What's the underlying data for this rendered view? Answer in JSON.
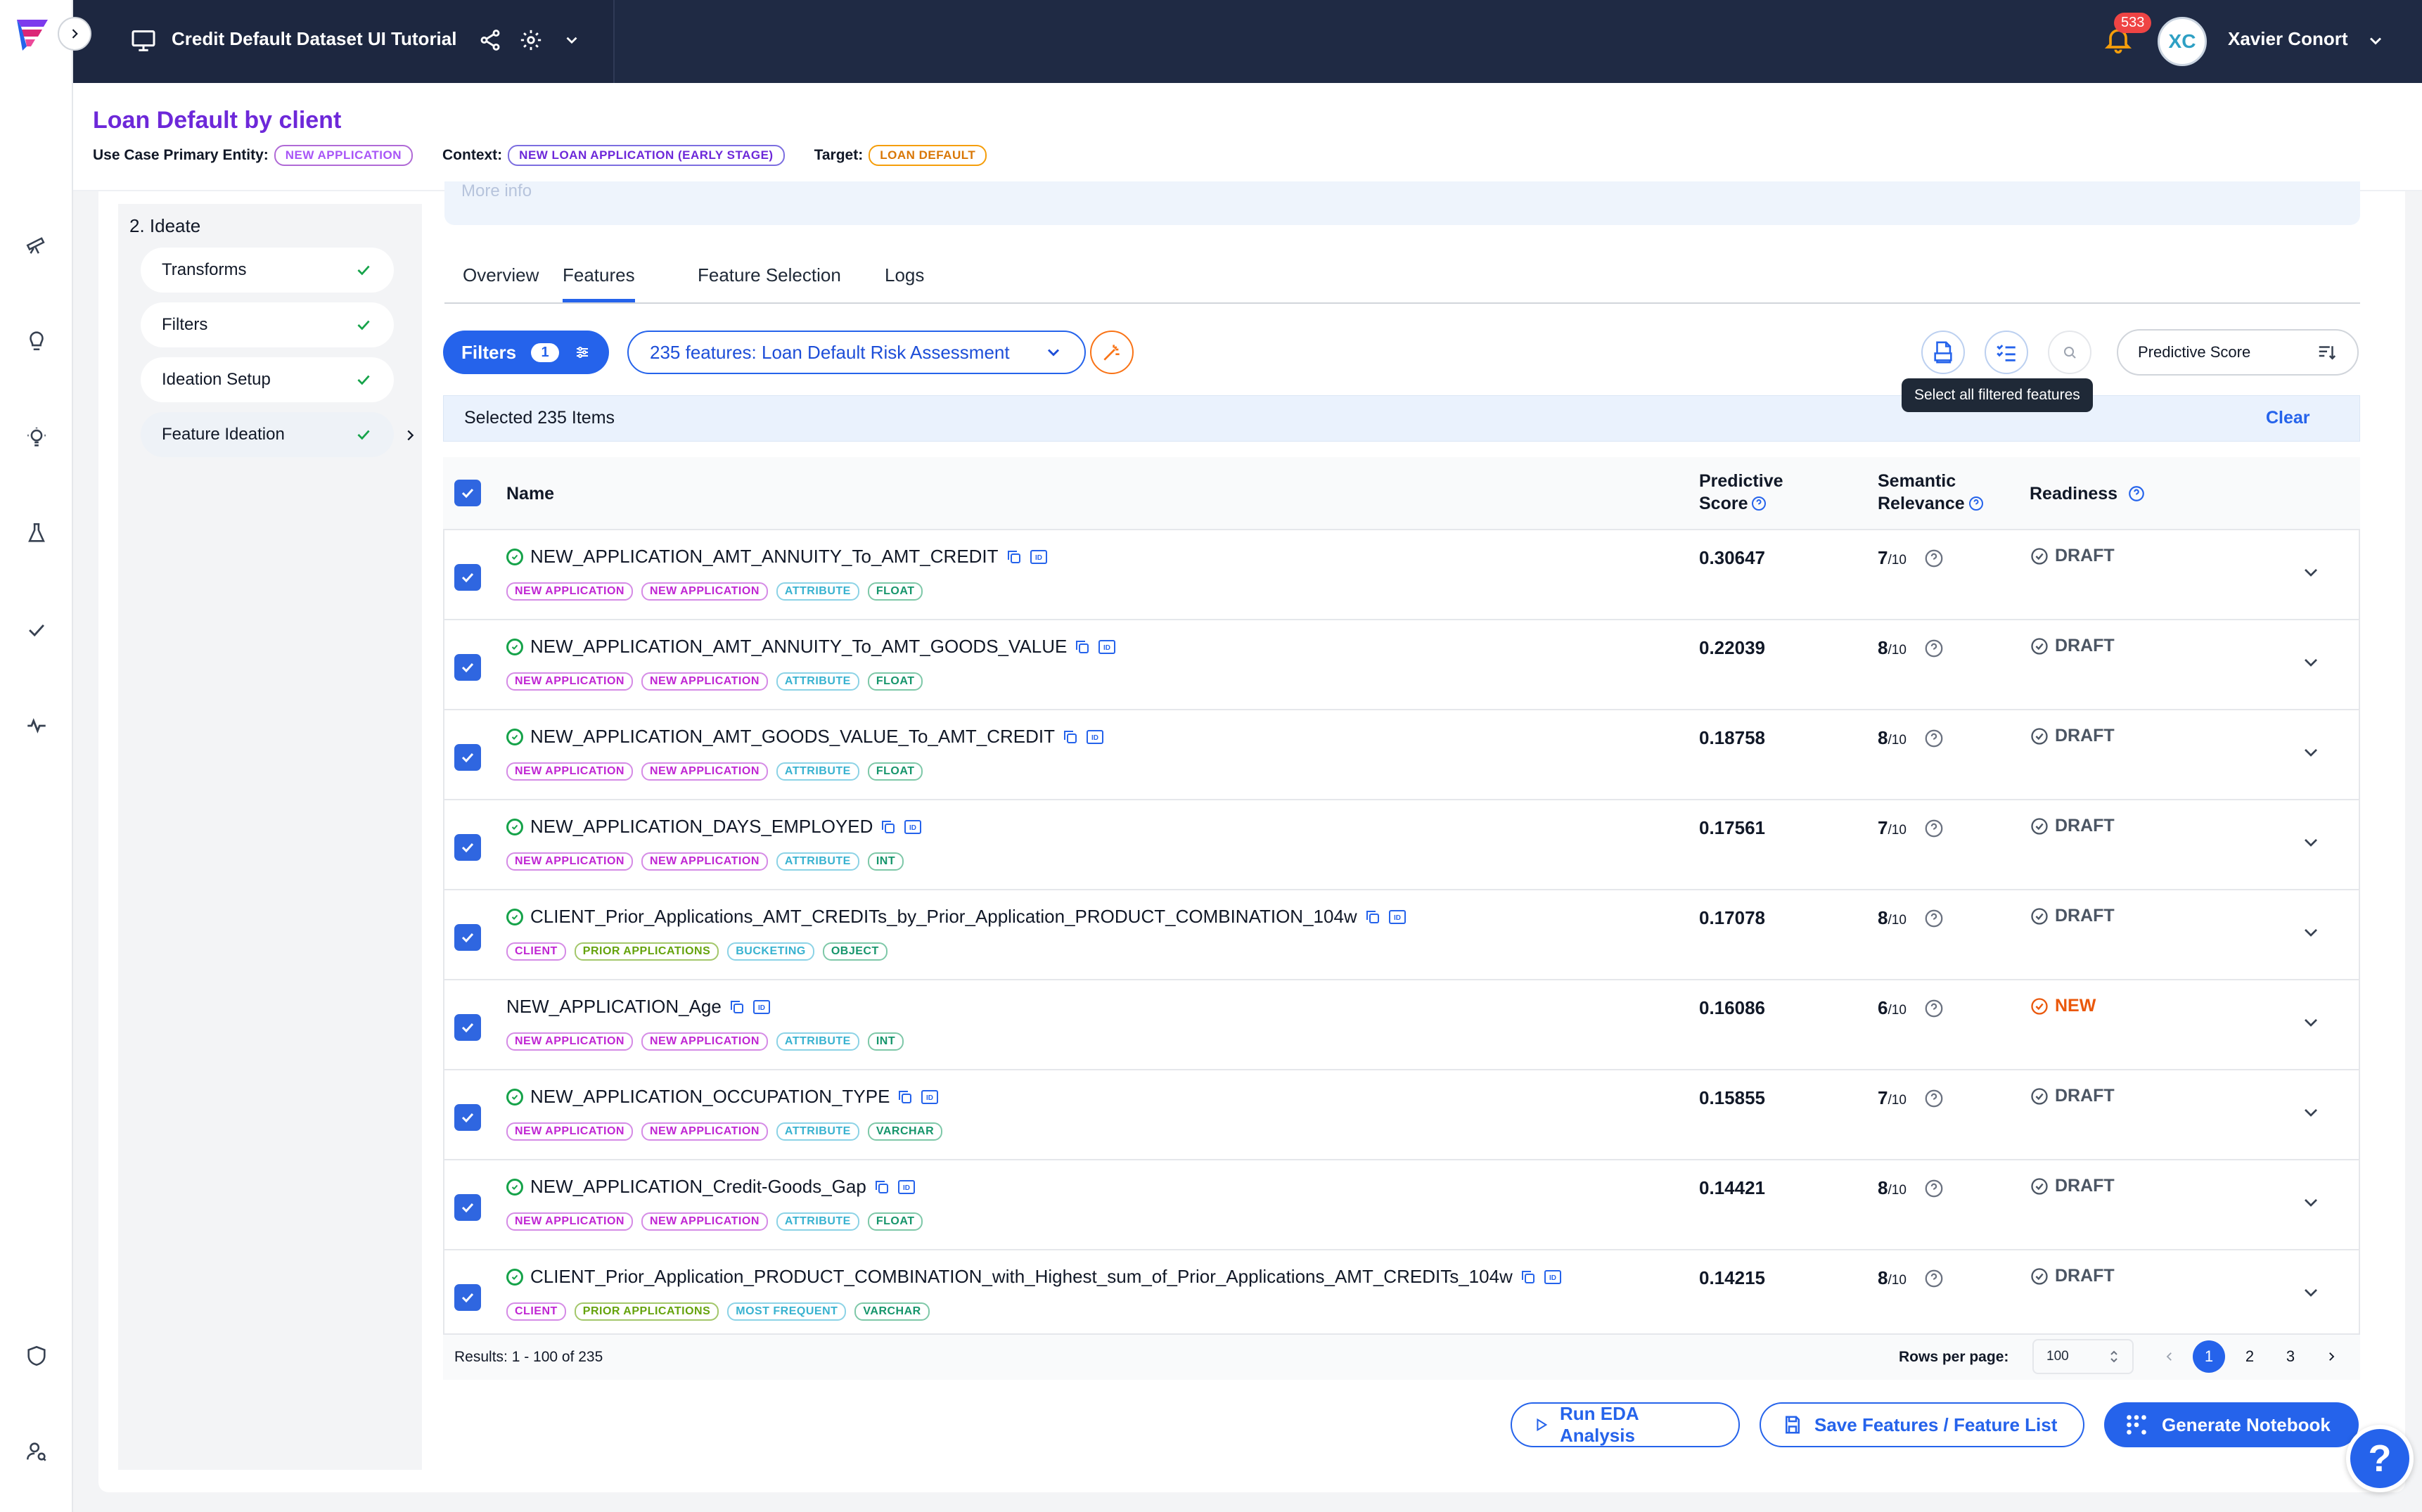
{
  "app": {
    "title": "Credit Default Dataset UI Tutorial",
    "notifications": "533",
    "user_initials": "XC",
    "user_name": "Xavier Conort"
  },
  "use_case": {
    "title": "Loan Default by client",
    "primary_entity_label": "Use Case Primary Entity:",
    "primary_entity": "NEW APPLICATION",
    "context_label": "Context:",
    "context": "NEW LOAN APPLICATION (EARLY STAGE)",
    "target_label": "Target:",
    "target": "LOAN DEFAULT"
  },
  "steps": {
    "title": "2. Ideate",
    "items": [
      {
        "label": "Transforms"
      },
      {
        "label": "Filters"
      },
      {
        "label": "Ideation Setup"
      },
      {
        "label": "Feature Ideation"
      }
    ]
  },
  "banner": {
    "more_info": "More info"
  },
  "tabs": [
    "Overview",
    "Features",
    "Feature Selection",
    "Logs"
  ],
  "toolbar": {
    "filters_label": "Filters",
    "filters_count": "1",
    "feature_list": "235 features: Loan Default Risk Assessment",
    "sort_by": "Predictive Score",
    "tooltip": "Select all filtered features"
  },
  "selection": {
    "text": "Selected 235 Items",
    "clear": "Clear"
  },
  "table": {
    "headers": {
      "name": "Name",
      "predictive_1": "Predictive",
      "predictive_2": "Score",
      "semantic_1": "Semantic",
      "semantic_2": "Relevance",
      "readiness": "Readiness"
    },
    "rows": [
      {
        "name": "NEW_APPLICATION_AMT_ANNUITY_To_AMT_CREDIT",
        "tags": [
          "NEW APPLICATION",
          "NEW APPLICATION",
          "ATTRIBUTE",
          "FLOAT"
        ],
        "score": "0.30647",
        "relevance": "7",
        "denom": "/10",
        "readiness": "DRAFT"
      },
      {
        "name": "NEW_APPLICATION_AMT_ANNUITY_To_AMT_GOODS_VALUE",
        "tags": [
          "NEW APPLICATION",
          "NEW APPLICATION",
          "ATTRIBUTE",
          "FLOAT"
        ],
        "score": "0.22039",
        "relevance": "8",
        "denom": "/10",
        "readiness": "DRAFT"
      },
      {
        "name": "NEW_APPLICATION_AMT_GOODS_VALUE_To_AMT_CREDIT",
        "tags": [
          "NEW APPLICATION",
          "NEW APPLICATION",
          "ATTRIBUTE",
          "FLOAT"
        ],
        "score": "0.18758",
        "relevance": "8",
        "denom": "/10",
        "readiness": "DRAFT"
      },
      {
        "name": "NEW_APPLICATION_DAYS_EMPLOYED",
        "tags": [
          "NEW APPLICATION",
          "NEW APPLICATION",
          "ATTRIBUTE",
          "INT"
        ],
        "score": "0.17561",
        "relevance": "7",
        "denom": "/10",
        "readiness": "DRAFT"
      },
      {
        "name": "CLIENT_Prior_Applications_AMT_CREDITs_by_Prior_Application_PRODUCT_COMBINATION_104w",
        "tags": [
          "CLIENT",
          "PRIOR APPLICATIONS",
          "BUCKETING",
          "OBJECT"
        ],
        "score": "0.17078",
        "relevance": "8",
        "denom": "/10",
        "readiness": "DRAFT"
      },
      {
        "name": "NEW_APPLICATION_Age",
        "tags": [
          "NEW APPLICATION",
          "NEW APPLICATION",
          "ATTRIBUTE",
          "INT"
        ],
        "score": "0.16086",
        "relevance": "6",
        "denom": "/10",
        "readiness": "NEW"
      },
      {
        "name": "NEW_APPLICATION_OCCUPATION_TYPE",
        "tags": [
          "NEW APPLICATION",
          "NEW APPLICATION",
          "ATTRIBUTE",
          "VARCHAR"
        ],
        "score": "0.15855",
        "relevance": "7",
        "denom": "/10",
        "readiness": "DRAFT"
      },
      {
        "name": "NEW_APPLICATION_Credit-Goods_Gap",
        "tags": [
          "NEW APPLICATION",
          "NEW APPLICATION",
          "ATTRIBUTE",
          "FLOAT"
        ],
        "score": "0.14421",
        "relevance": "8",
        "denom": "/10",
        "readiness": "DRAFT"
      },
      {
        "name": "CLIENT_Prior_Application_PRODUCT_COMBINATION_with_Highest_sum_of_Prior_Applications_AMT_CREDITs_104w",
        "tags": [
          "CLIENT",
          "PRIOR APPLICATIONS",
          "MOST FREQUENT",
          "VARCHAR"
        ],
        "score": "0.14215",
        "relevance": "8",
        "denom": "/10",
        "readiness": "DRAFT"
      }
    ]
  },
  "footer": {
    "results": "Results: 1 - 100 of 235",
    "rows_per_page_label": "Rows per page:",
    "rows_per_page": "100",
    "pages": [
      "1",
      "2",
      "3"
    ]
  },
  "actions": {
    "run_eda": "Run EDA Analysis",
    "save": "Save Features / Feature List",
    "generate": "Generate Notebook"
  },
  "help": "?"
}
